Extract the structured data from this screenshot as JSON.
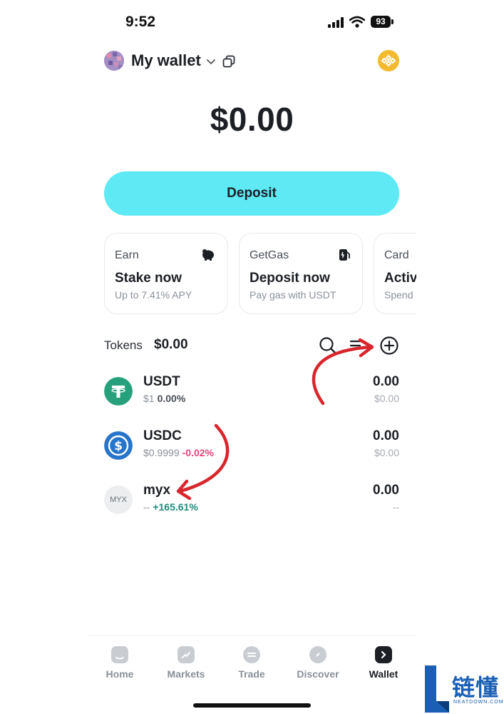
{
  "status_bar": {
    "time": "9:52",
    "battery": "93"
  },
  "header": {
    "wallet_name": "My wallet"
  },
  "balance": "$0.00",
  "deposit_label": "Deposit",
  "cards": [
    {
      "category": "Earn",
      "title": "Stake now",
      "subtitle": "Up to 7.41% APY",
      "icon": "piggy-bank-icon"
    },
    {
      "category": "GetGas",
      "title": "Deposit now",
      "subtitle": "Pay gas with USDT",
      "icon": "gas-pump-icon"
    },
    {
      "category": "Card",
      "title": "Activ",
      "subtitle": "Spend",
      "icon": ""
    }
  ],
  "tokens": {
    "label": "Tokens",
    "total": "$0.00",
    "items": [
      {
        "symbol": "USDT",
        "price": "$1",
        "change": "0.00%",
        "amount": "0.00",
        "value": "$0.00",
        "color": "#26a17b"
      },
      {
        "symbol": "USDC",
        "price": "$0.9999",
        "change": "-0.02%",
        "amount": "0.00",
        "value": "$0.00",
        "color": "#2775ca"
      },
      {
        "symbol": "myx",
        "logo_text": "MYX",
        "price": "--",
        "change": "+165.61%",
        "amount": "0.00",
        "value": "--",
        "color": "#eceef0"
      }
    ]
  },
  "nav": [
    {
      "label": "Home",
      "icon": "home-icon"
    },
    {
      "label": "Markets",
      "icon": "markets-icon"
    },
    {
      "label": "Trade",
      "icon": "trade-icon"
    },
    {
      "label": "Discover",
      "icon": "discover-icon"
    },
    {
      "label": "Wallet",
      "icon": "wallet-icon",
      "active": true
    }
  ],
  "watermark": {
    "chinese": "链懂",
    "english": "NEATDOWN.COM"
  },
  "colors": {
    "accent": "#5ee9f4",
    "negative": "#e5457a",
    "positive": "#1f8a7a",
    "annotation_arrow": "#d8262c"
  }
}
